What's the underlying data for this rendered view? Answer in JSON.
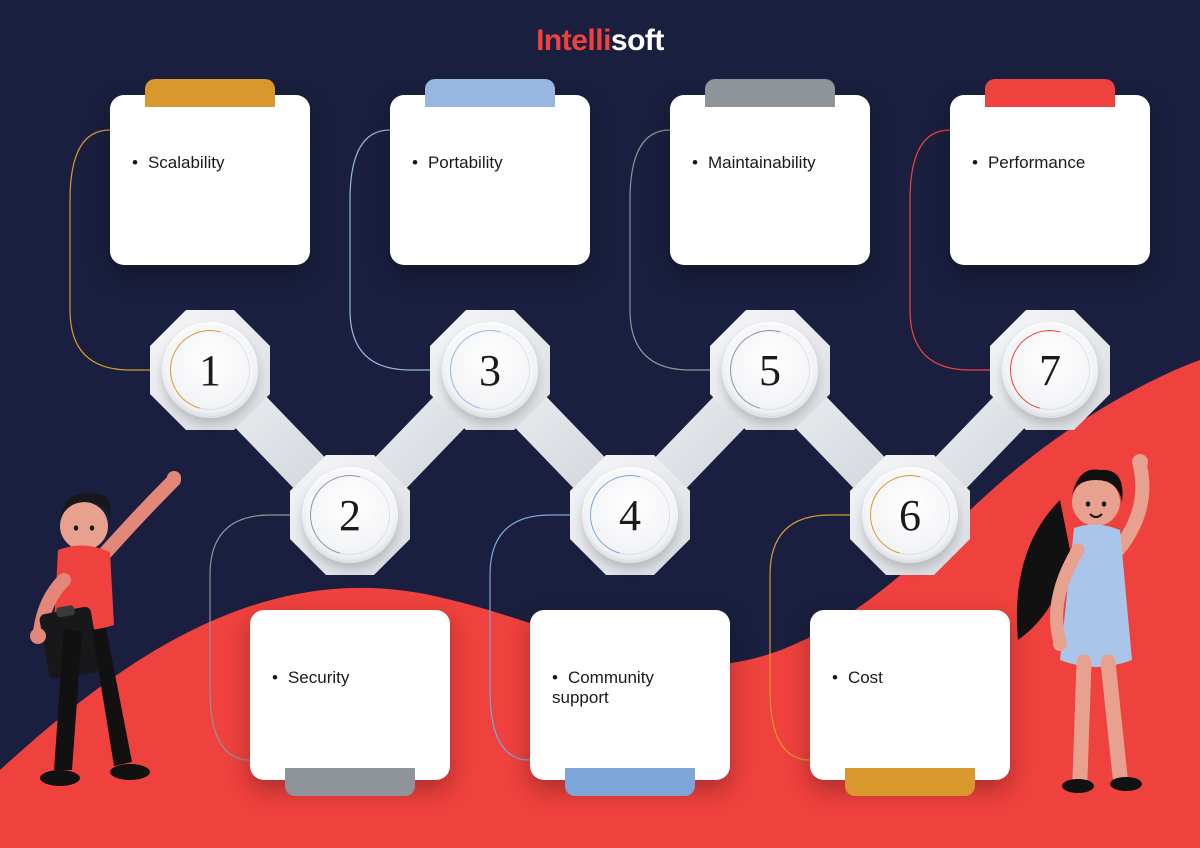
{
  "brand": {
    "part1": "Intelli",
    "part2": "soft"
  },
  "items": [
    {
      "num": "1",
      "label": "Scalability",
      "accent": "#d8982e",
      "pos": "top"
    },
    {
      "num": "2",
      "label": "Security",
      "accent": "#8e9499",
      "pos": "bottom"
    },
    {
      "num": "3",
      "label": "Portability",
      "accent": "#97b7e1",
      "pos": "top"
    },
    {
      "num": "4",
      "label": "Community support",
      "accent": "#7da5d8",
      "pos": "bottom"
    },
    {
      "num": "5",
      "label": "Maintainability",
      "accent": "#8e9499",
      "pos": "top"
    },
    {
      "num": "6",
      "label": "Cost",
      "accent": "#d8982e",
      "pos": "bottom"
    },
    {
      "num": "7",
      "label": "Performance",
      "accent": "#ef413d",
      "pos": "top"
    }
  ],
  "layout": {
    "topY": 310,
    "bottomY": 455,
    "nodeXs": [
      150,
      290,
      430,
      570,
      710,
      850,
      990
    ],
    "cardTopY": 95,
    "cardBottomY": 610,
    "cardXOffset": -40
  }
}
